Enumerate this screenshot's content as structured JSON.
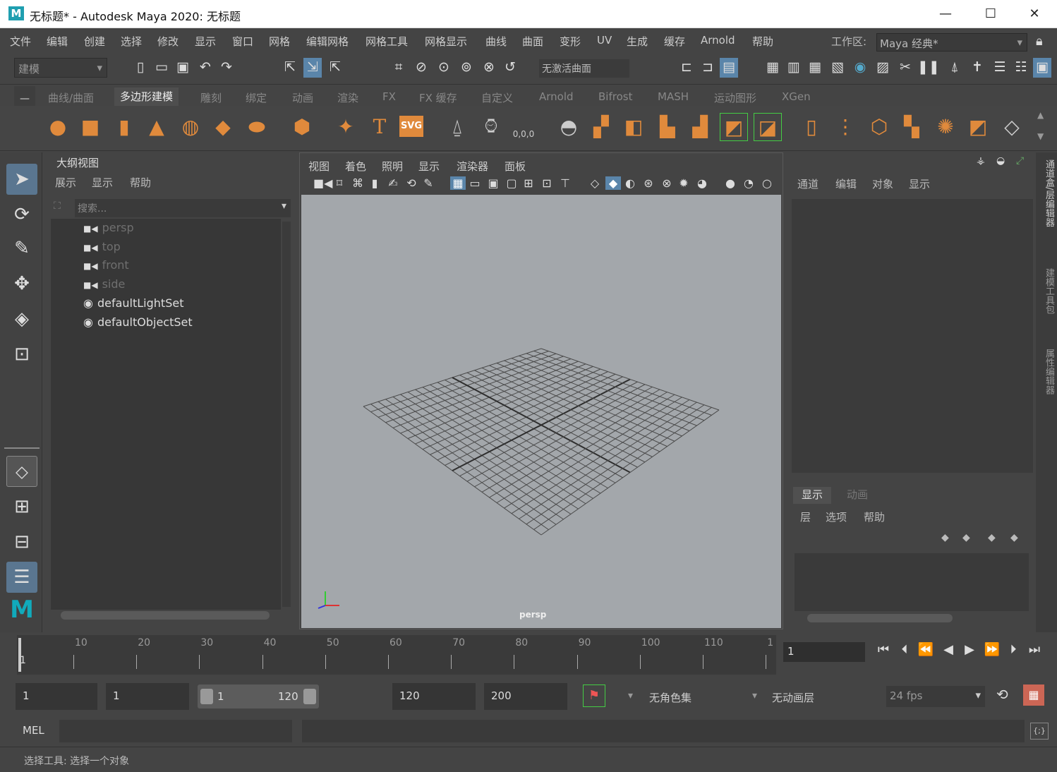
{
  "window": {
    "title": "无标题* - Autodesk Maya 2020: 无标题",
    "logo": "M",
    "minimize": "—",
    "maximize": "☐",
    "close": "✕"
  },
  "menubar": {
    "items": [
      "文件",
      "编辑",
      "创建",
      "选择",
      "修改",
      "显示",
      "窗口",
      "网格",
      "编辑网格",
      "网格工具",
      "网格显示",
      "曲线",
      "曲面",
      "变形",
      "UV",
      "生成",
      "缓存",
      "Arnold",
      "帮助"
    ],
    "workspace_label": "工作区:",
    "workspace_value": "Maya 经典*"
  },
  "status_line": {
    "mode": "建模",
    "curve_field": "无激活曲面"
  },
  "shelf": {
    "tabs": [
      "曲线/曲面",
      "多边形建模",
      "雕刻",
      "绑定",
      "动画",
      "渲染",
      "FX",
      "FX 缓存",
      "自定义",
      "Arnold",
      "Bifrost",
      "MASH",
      "运动图形",
      "XGen"
    ],
    "active_tab": "多边形建模",
    "svg_label": "SVG",
    "text_label": "T",
    "coord_label": "0,0,0"
  },
  "outliner": {
    "title": "大纲视图",
    "menu": [
      "展示",
      "显示",
      "帮助"
    ],
    "search_placeholder": "搜索...",
    "items": [
      {
        "name": "persp",
        "type": "camera"
      },
      {
        "name": "top",
        "type": "camera"
      },
      {
        "name": "front",
        "type": "camera"
      },
      {
        "name": "side",
        "type": "camera"
      },
      {
        "name": "defaultLightSet",
        "type": "set"
      },
      {
        "name": "defaultObjectSet",
        "type": "set"
      }
    ]
  },
  "viewport": {
    "menu": [
      "视图",
      "着色",
      "照明",
      "显示",
      "渲染器",
      "面板"
    ],
    "camera": "persp"
  },
  "channel_box": {
    "menu": [
      "通道",
      "编辑",
      "对象",
      "显示"
    ],
    "layer_tabs": [
      "显示",
      "动画"
    ],
    "layer_menu": [
      "层",
      "选项",
      "帮助"
    ]
  },
  "side_tabs": [
    "通道盒/层编辑器",
    "建模工具包",
    "属性编辑器"
  ],
  "timeline": {
    "ticks": [
      "10",
      "20",
      "30",
      "40",
      "50",
      "60",
      "70",
      "80",
      "90",
      "100",
      "110",
      "1"
    ],
    "current_frame": "1",
    "start_edge": "1"
  },
  "range": {
    "start": "1",
    "playback_start": "1",
    "slider_start": "1",
    "slider_end": "120",
    "playback_end": "120",
    "end": "200",
    "character_set": "无角色集",
    "anim_layer": "无动画层",
    "fps": "24 fps"
  },
  "command_line": {
    "label": "MEL"
  },
  "help_line": {
    "text": "选择工具: 选择一个对象"
  },
  "colors": {
    "accent_orange": "#e08a3c",
    "select_blue": "#5a7690",
    "viewport_bg": "#a3a7ab",
    "ui_bg": "#444444"
  }
}
